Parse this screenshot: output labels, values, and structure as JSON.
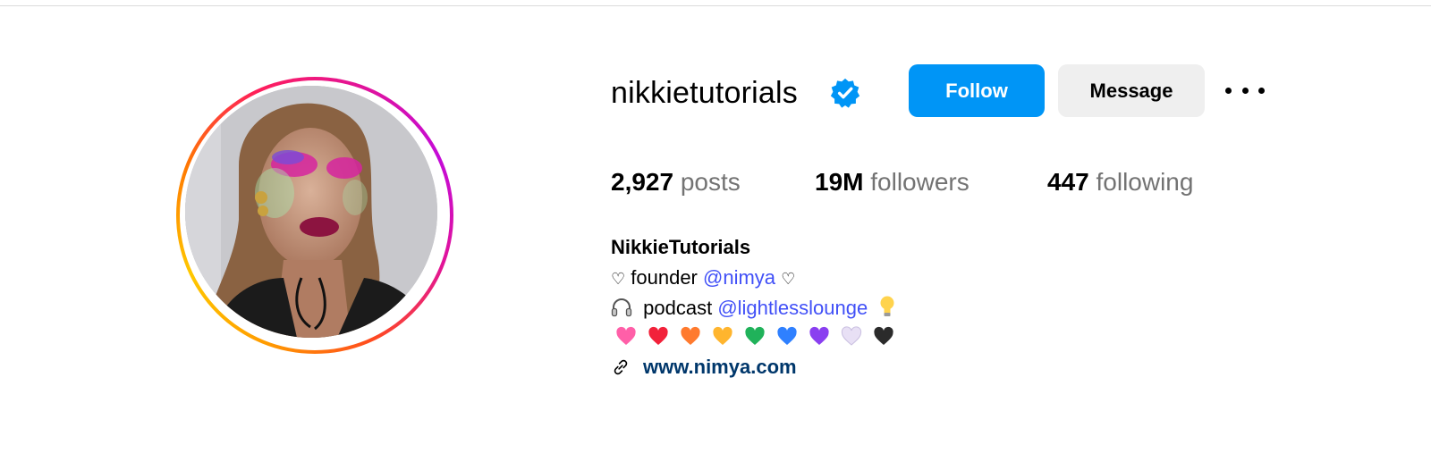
{
  "profile": {
    "username": "nikkietutorials",
    "verified_icon": "verified-badge-icon",
    "follow_label": "Follow",
    "message_label": "Message",
    "more_icon": "more-options-icon"
  },
  "stats": {
    "posts_count": "2,927",
    "posts_label": "posts",
    "followers_count": "19M",
    "followers_label": "followers",
    "following_count": "447",
    "following_label": "following"
  },
  "bio": {
    "display_name": "NikkieTutorials",
    "line1_heart_left": "♡",
    "line1_text": "founder",
    "line1_mention": "@nimya",
    "line1_heart_right": "♡",
    "line2_icon": "headphones-icon",
    "line2_text": "podcast",
    "line2_mention": "@lightlesslounge",
    "line2_icon_end": "lightbulb-icon",
    "hearts": [
      "#ff5fa8",
      "#f2213a",
      "#ff7a2e",
      "#ffb52e",
      "#20b25a",
      "#2f80ff",
      "#8a3ff0",
      "#e8e0f5",
      "#2b2b2b"
    ],
    "link_icon": "link-icon",
    "website": "www.nimya.com"
  },
  "colors": {
    "follow_bg": "#0095f6",
    "mention": "#4150f7",
    "website": "#00376b",
    "secondary_text": "#737373"
  }
}
